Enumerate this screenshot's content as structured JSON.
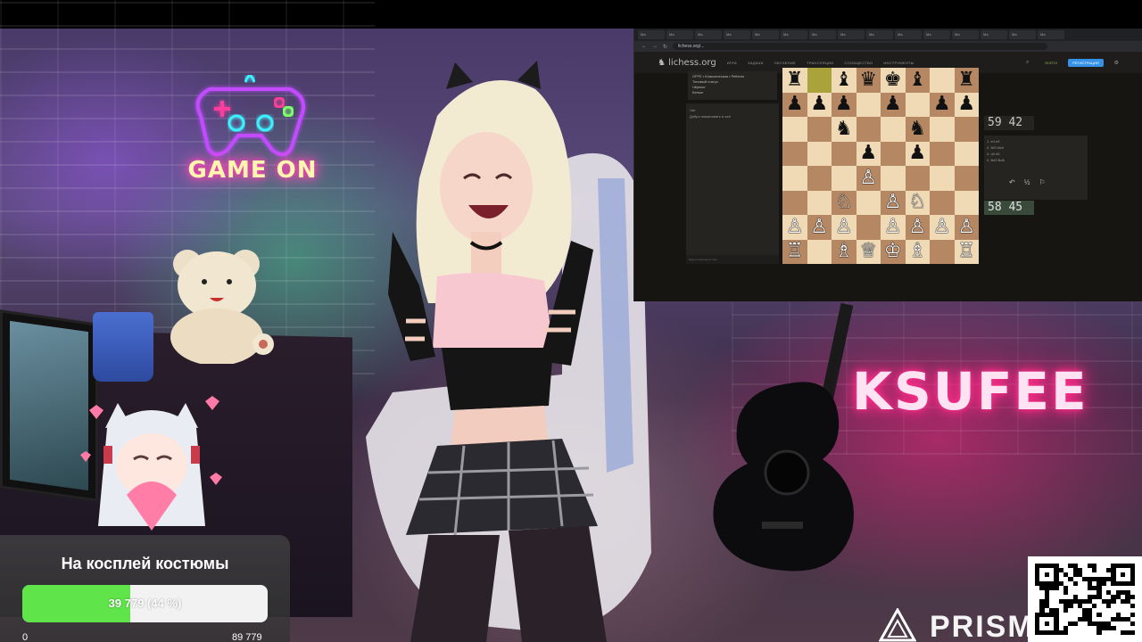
{
  "stream": {
    "neon_left_text": "GAME ON",
    "neon_right_text": "KSUFEE",
    "brand_watermark": "PRISM"
  },
  "browser": {
    "url": "lichess.org/...",
    "tabs": [
      "Ма",
      "Ма",
      "Ма",
      "Ма",
      "Ма",
      "Ма",
      "Ма",
      "Ма",
      "Ма",
      "Ма",
      "Ма",
      "Ма",
      "Ма",
      "Ма",
      "Ма"
    ]
  },
  "lichess": {
    "logo": "lichess.org",
    "nav": [
      "ИГРА",
      "ЗАДАЧИ",
      "ОБУЧЕНИЕ",
      "ТРАНСЛЯЦИИ",
      "СООБЩЕСТВО",
      "ИНСТРУМЕНТЫ"
    ],
    "signin": "ВОЙТИ",
    "register": "РЕГИСТРАЦИЯ",
    "game_info": [
      "OFFE • Классическая • Рейтинг",
      "Топовый статус",
      "Чёрные",
      "Белые"
    ],
    "chat_title": "Чат",
    "chat_lines": [
      "Добро пожаловать в чат!"
    ],
    "chat_placeholder": "Будьте вежливы в чате",
    "clock_top": "59 42",
    "clock_bottom": "58 45",
    "player_top": "Чёрные",
    "player_bottom": "Белые",
    "moves": [
      "1. e4  e5",
      "2. Nf3  Nc6",
      "3. d4  d5",
      "4. Bd3  Bd6"
    ],
    "board": [
      [
        "br",
        "",
        "bb",
        "bq",
        "bk",
        "bb",
        "",
        "br"
      ],
      [
        "bp",
        "bp",
        "bp",
        "",
        "bp",
        "",
        "bp",
        "bp"
      ],
      [
        "",
        "",
        "bn",
        "",
        "",
        "bn",
        "",
        ""
      ],
      [
        "",
        "",
        "",
        "bp",
        "",
        "bp",
        "",
        ""
      ],
      [
        "",
        "",
        "",
        "wp",
        "",
        "",
        "",
        ""
      ],
      [
        "",
        "",
        "wn",
        "",
        "wp",
        "wn",
        "",
        ""
      ],
      [
        "wp",
        "wp",
        "wp",
        "",
        "wp",
        "wp",
        "wp",
        "wp"
      ],
      [
        "wr",
        "",
        "wb",
        "wq",
        "wk",
        "wb",
        "",
        "wr"
      ]
    ],
    "highlight": [
      [
        0,
        1
      ]
    ]
  },
  "donation_goal": {
    "title": "На косплей костюмы",
    "progress_text": "39 779 (44 %)",
    "progress_fraction": 0.44,
    "min_label": "0",
    "max_label": "89 779",
    "fill_color": "#5fe44a"
  }
}
